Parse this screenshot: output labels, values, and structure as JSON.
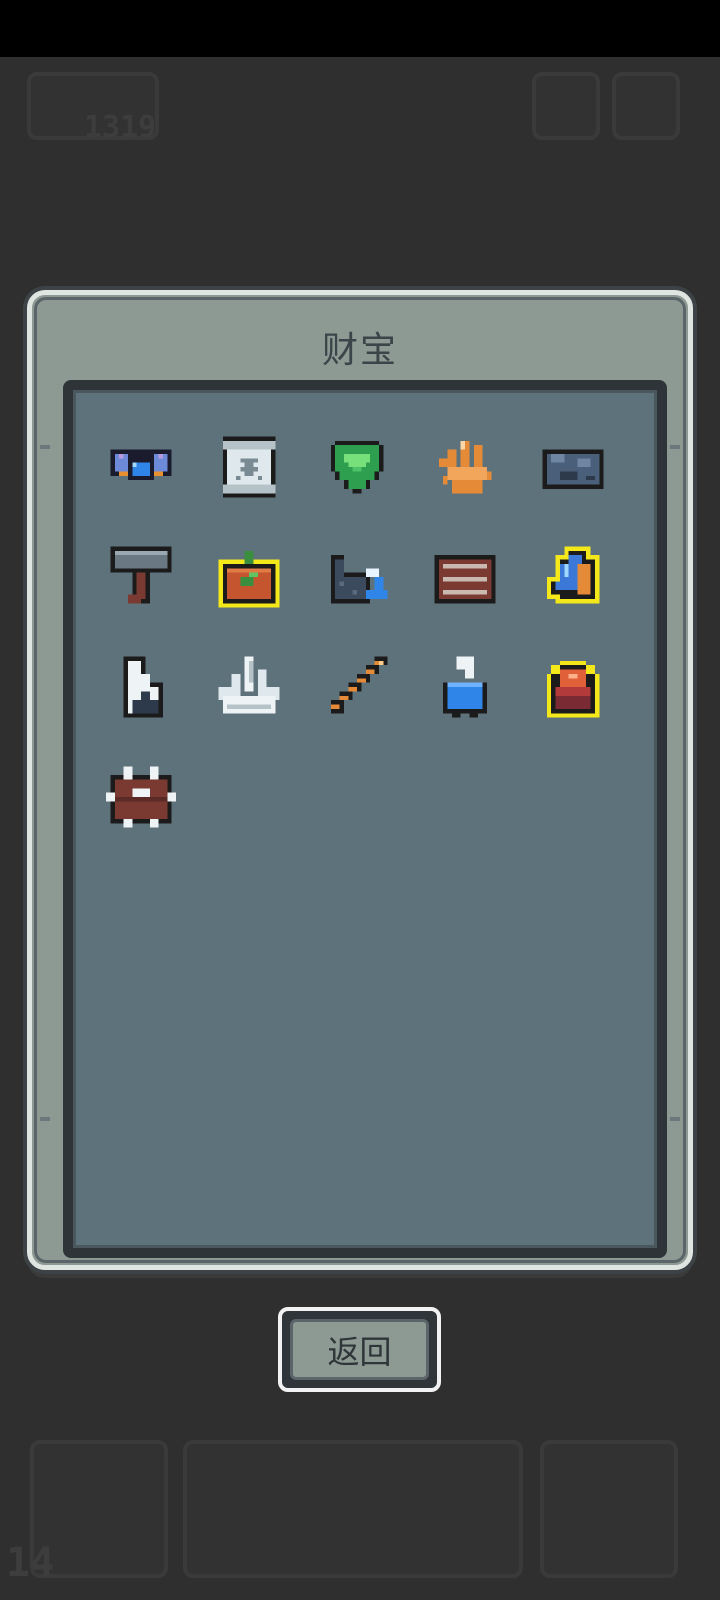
{
  "hud": {
    "coins": "1319",
    "level": "14"
  },
  "dialog": {
    "title": "财宝",
    "back_label": "返回"
  },
  "treasures": [
    {
      "icon": "blue-goggles-icon"
    },
    {
      "icon": "skull-scroll-icon"
    },
    {
      "icon": "green-gem-icon"
    },
    {
      "icon": "orange-coral-icon"
    },
    {
      "icon": "dark-ore-icon"
    },
    {
      "icon": "stone-hammer-icon"
    },
    {
      "icon": "seedling-crate-icon",
      "rare": true
    },
    {
      "icon": "wave-wall-icon"
    },
    {
      "icon": "wooden-chest-icon"
    },
    {
      "icon": "blue-crystal-icon",
      "rare": true
    },
    {
      "icon": "snow-rock-icon"
    },
    {
      "icon": "ice-crystal-icon"
    },
    {
      "icon": "wooden-stick-icon"
    },
    {
      "icon": "blue-bottle-icon"
    },
    {
      "icon": "red-dome-icon",
      "rare": true
    },
    {
      "icon": "spiked-barrel-icon"
    }
  ],
  "colors": {
    "background": "#2f2f2f",
    "dialog": "#8c9a93",
    "inner": "#5e727b",
    "rare_outline": "#f4e81a"
  }
}
